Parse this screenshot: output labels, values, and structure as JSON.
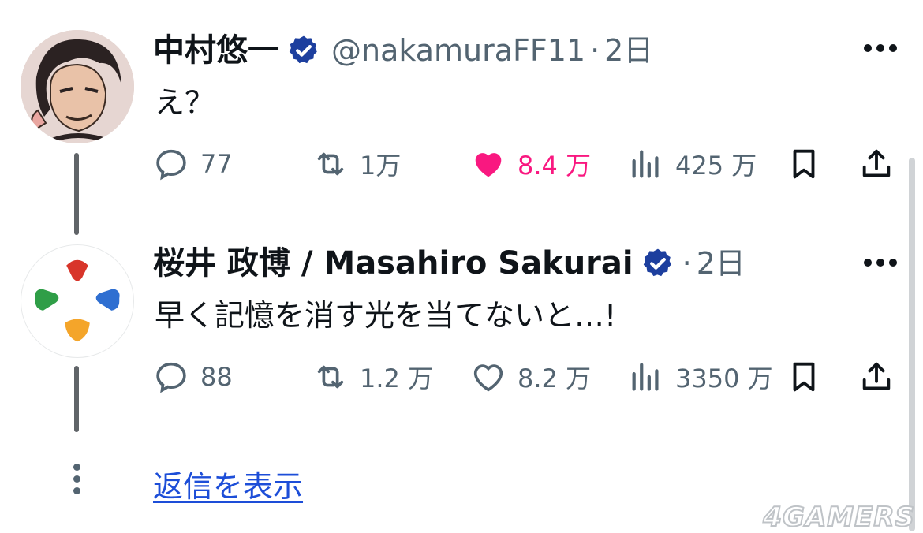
{
  "tweets": [
    {
      "display_name": "中村悠一",
      "handle": "@nakamuraFF11",
      "separator": "·",
      "time": "2日",
      "text": "え？",
      "avatar_icon": "illustrated-portrait",
      "replies": "77",
      "reposts": "1万",
      "likes": "8.4 万",
      "liked": true,
      "views": "425 万"
    },
    {
      "display_name": "桜井 政博 / Masahiro Sakurai",
      "separator": "·",
      "time": "2日",
      "text": "早く記憶を消す光を当てないと…!",
      "avatar_icon": "four-color-dpad-logo",
      "replies": "88",
      "reposts": "1.2 万",
      "likes": "8.2 万",
      "liked": false,
      "views": "3350 万"
    }
  ],
  "show_replies": "返信を表示",
  "watermark": "4GAMERS",
  "colors": {
    "like_active": "#f91880",
    "verified": "#1d3f9e",
    "link": "#1d4ed8",
    "muted": "#536471"
  },
  "icons": [
    "reply-icon",
    "repost-icon",
    "like-icon",
    "views-icon",
    "bookmark-icon",
    "share-icon",
    "more-icon",
    "verified-badge-icon"
  ]
}
